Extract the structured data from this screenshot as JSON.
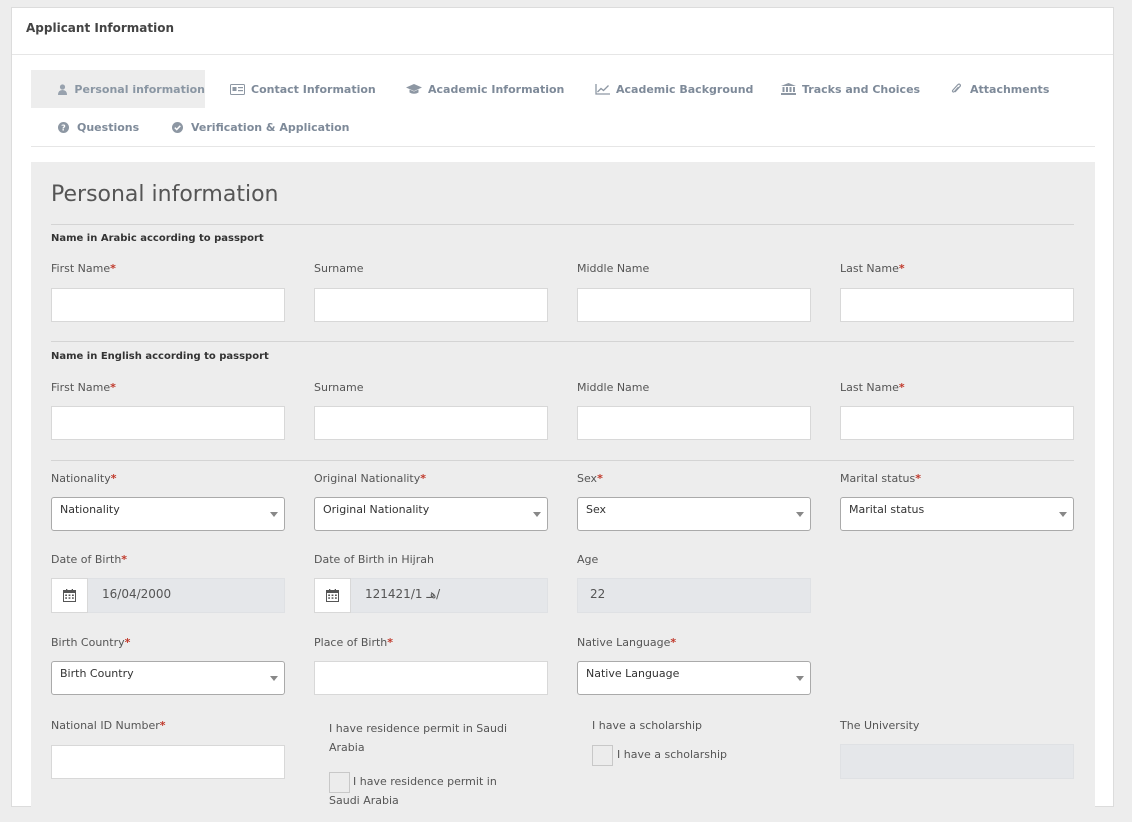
{
  "panel": {
    "title": "Applicant Information"
  },
  "tabs": [
    {
      "label": "Personal information",
      "icon": "user-icon",
      "active": true
    },
    {
      "label": "Contact Information",
      "icon": "id-card-icon"
    },
    {
      "label": "Academic Information",
      "icon": "graduation-cap-icon"
    },
    {
      "label": "Academic Background",
      "icon": "line-chart-icon"
    },
    {
      "label": "Tracks and Choices",
      "icon": "institution-icon"
    },
    {
      "label": "Attachments",
      "icon": "paperclip-icon"
    },
    {
      "label": "Questions",
      "icon": "question-circle-icon"
    },
    {
      "label": "Verification & Application",
      "icon": "check-circle-icon"
    }
  ],
  "form": {
    "title": "Personal information",
    "arabic_section": "Name in Arabic according to passport",
    "english_section": "Name in English according to passport",
    "name_fields": {
      "first": "First Name",
      "surname": "Surname",
      "middle": "Middle Name",
      "last": "Last Name"
    },
    "nationality": {
      "label": "Nationality",
      "value": "Nationality"
    },
    "original_nationality": {
      "label": "Original Nationality",
      "value": "Original Nationality"
    },
    "sex": {
      "label": "Sex",
      "value": "Sex"
    },
    "marital_status": {
      "label": "Marital status",
      "value": "Marital status"
    },
    "dob": {
      "label": "Date of Birth",
      "value": "16/04/2000"
    },
    "dob_hijri": {
      "label": "Date of Birth in Hijrah",
      "value": "12هـ 1421/1/"
    },
    "age": {
      "label": "Age",
      "value": "22"
    },
    "birth_country": {
      "label": "Birth Country",
      "value": "Birth Country"
    },
    "place_of_birth": {
      "label": "Place of Birth"
    },
    "native_language": {
      "label": "Native Language",
      "value": "Native Language"
    },
    "national_id": {
      "label": "National ID Number"
    },
    "residence_permit": {
      "label": "I have residence permit in Saudi Arabia",
      "checkbox_label": "I have residence permit in Saudi Arabia"
    },
    "scholarship": {
      "label": "I have a scholarship",
      "checkbox_label": "I have a scholarship"
    },
    "university": {
      "label": "The University"
    },
    "required_mark": "*"
  },
  "colors": {
    "required": "#c0392b",
    "tab_text": "#7e8a99",
    "panel_bg": "#ededed"
  }
}
